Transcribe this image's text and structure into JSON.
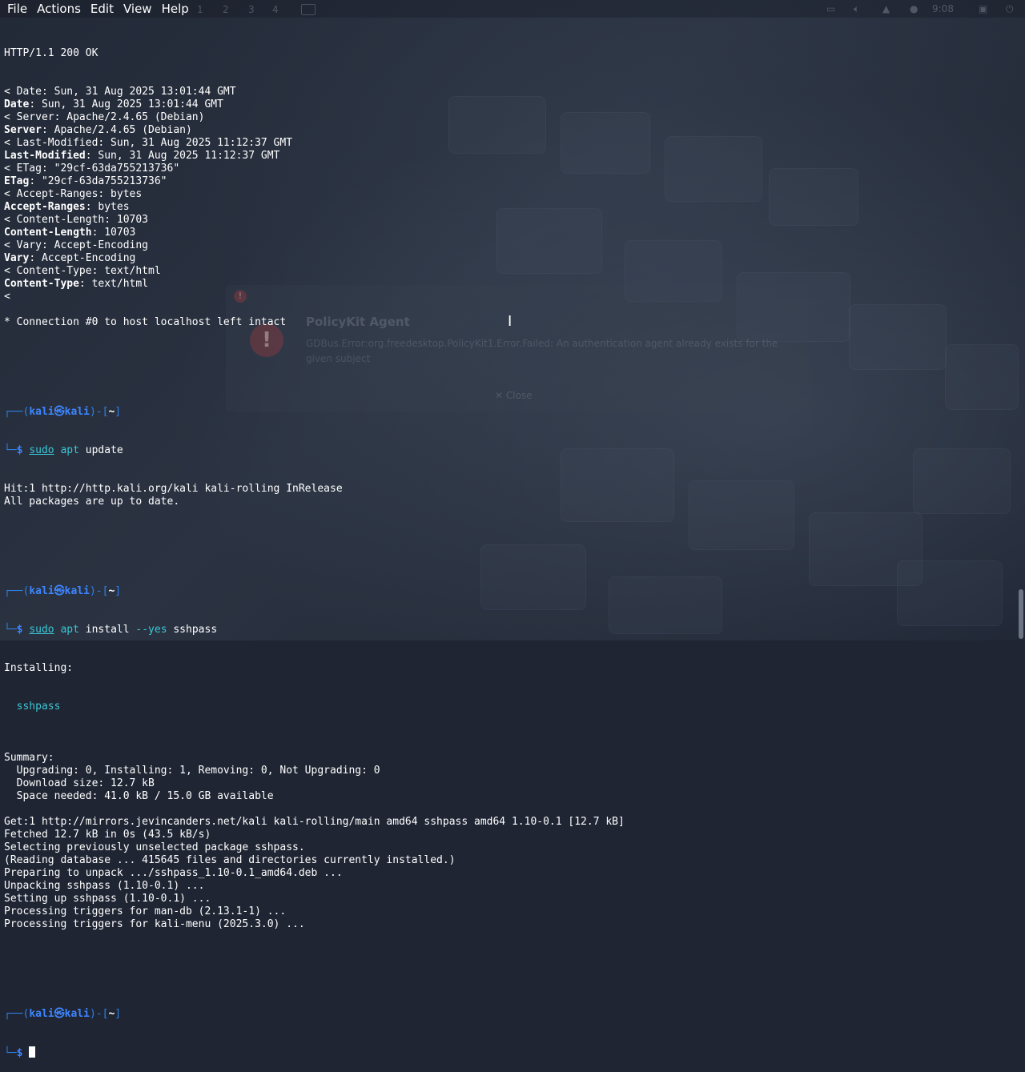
{
  "menubar": [
    "File",
    "Actions",
    "Edit",
    "View",
    "Help"
  ],
  "panel": {
    "workspaces": [
      "1",
      "2",
      "3",
      "4"
    ],
    "clock": "9:08"
  },
  "polkit_dialog": {
    "title": "PolicyKit Agent",
    "message": "GDBus.Error:org.freedesktop.PolicyKit1.Error.Failed: An authentication agent already exists for the given subject",
    "close_label": "Close"
  },
  "prompt": {
    "user": "kali",
    "host": "kali",
    "at_symbol": "㉿",
    "path": "~"
  },
  "output_headers": [
    "< Date: Sun, 31 Aug 2025 13:01:44 GMT",
    [
      "Date",
      ": Sun, 31 Aug 2025 13:01:44 GMT"
    ],
    "< Server: Apache/2.4.65 (Debian)",
    [
      "Server",
      ": Apache/2.4.65 (Debian)"
    ],
    "< Last-Modified: Sun, 31 Aug 2025 11:12:37 GMT",
    [
      "Last-Modified",
      ": Sun, 31 Aug 2025 11:12:37 GMT"
    ],
    "< ETag: \"29cf-63da755213736\"",
    [
      "ETag",
      ": \"29cf-63da755213736\""
    ],
    "< Accept-Ranges: bytes",
    [
      "Accept-Ranges",
      ": bytes"
    ],
    "< Content-Length: 10703",
    [
      "Content-Length",
      ": 10703"
    ],
    "< Vary: Accept-Encoding",
    [
      "Vary",
      ": Accept-Encoding"
    ],
    "< Content-Type: text/html",
    [
      "Content-Type",
      ": text/html"
    ],
    "<",
    "",
    "* Connection #0 to host localhost left intact"
  ],
  "first_line": "HTTP/1.1 200 OK",
  "cmd1": {
    "sudo": "sudo",
    "apt": "apt",
    "rest": " update"
  },
  "cmd1_output": [
    "Hit:1 http://http.kali.org/kali kali-rolling InRelease",
    "All packages are up to date."
  ],
  "cmd2": {
    "sudo": "sudo",
    "apt": "apt",
    "mid": " install ",
    "flag": "--yes",
    "rest": " sshpass"
  },
  "cmd2_installing": "Installing:",
  "cmd2_pkg": "  sshpass",
  "cmd2_output": [
    "",
    "Summary:",
    "  Upgrading: 0, Installing: 1, Removing: 0, Not Upgrading: 0",
    "  Download size: 12.7 kB",
    "  Space needed: 41.0 kB / 15.0 GB available",
    "",
    "Get:1 http://mirrors.jevincanders.net/kali kali-rolling/main amd64 sshpass amd64 1.10-0.1 [12.7 kB]",
    "Fetched 12.7 kB in 0s (43.5 kB/s)",
    "Selecting previously unselected package sshpass.",
    "(Reading database ... 415645 files and directories currently installed.)",
    "Preparing to unpack .../sshpass_1.10-0.1_amd64.deb ...",
    "Unpacking sshpass (1.10-0.1) ...",
    "Setting up sshpass (1.10-0.1) ...",
    "Processing triggers for man-db (2.13.1-1) ...",
    "Processing triggers for kali-menu (2025.3.0) ..."
  ]
}
